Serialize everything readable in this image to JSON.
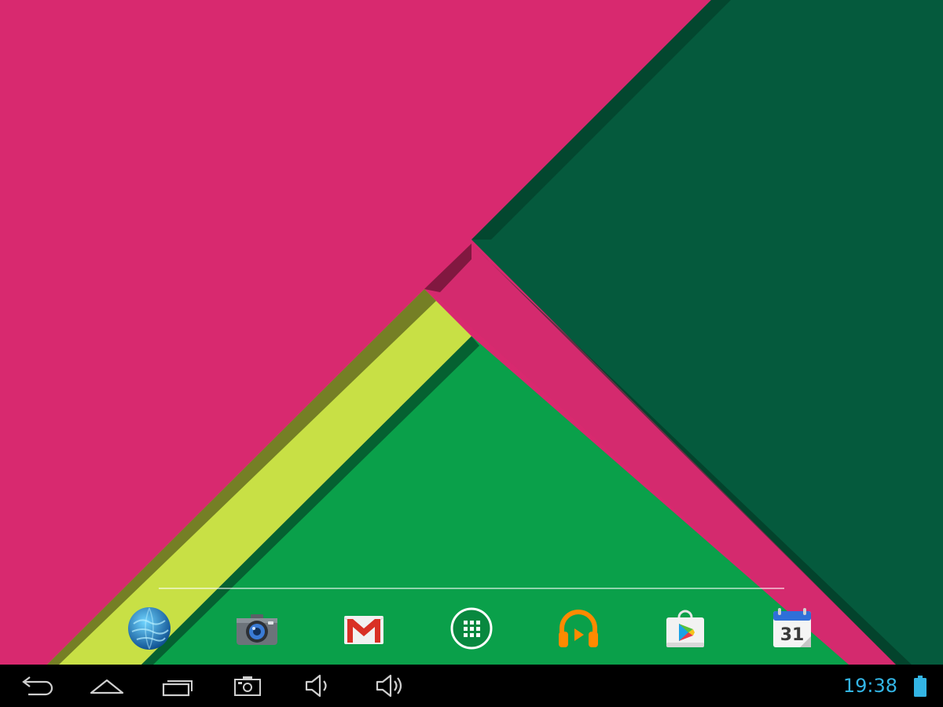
{
  "status_bar": {
    "time": "19:38",
    "battery_icon": "battery-icon",
    "clock_color": "#33b5e5"
  },
  "wallpaper": {
    "colors": {
      "pink": "#d8296f",
      "dark_green": "#055a3d",
      "lime": "#c8e045",
      "green": "#0aa04a"
    }
  },
  "dock": {
    "apps": [
      {
        "name": "browser",
        "icon": "globe-icon"
      },
      {
        "name": "camera",
        "icon": "camera-icon"
      },
      {
        "name": "gmail",
        "icon": "gmail-icon"
      },
      {
        "name": "all-apps",
        "icon": "app-drawer-icon"
      },
      {
        "name": "play-music",
        "icon": "headphones-icon"
      },
      {
        "name": "play-store",
        "icon": "play-store-icon"
      },
      {
        "name": "calendar",
        "icon": "calendar-icon",
        "label": "31"
      }
    ]
  },
  "navigation_bar": {
    "buttons": [
      "back-icon",
      "home-icon",
      "recent-apps-icon",
      "screenshot-icon",
      "volume-down-icon",
      "volume-up-icon"
    ]
  }
}
